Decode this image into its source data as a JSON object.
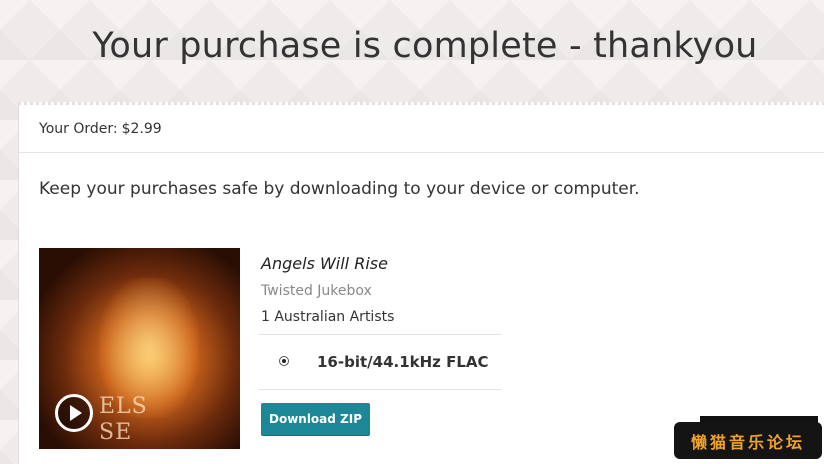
{
  "page": {
    "title": "Your purchase is complete - thankyou"
  },
  "order": {
    "label": "Your Order:",
    "total": "$2.99"
  },
  "message": "Keep your purchases safe by downloading to your device or computer.",
  "album": {
    "title": "Angels Will Rise",
    "artist": "Twisted Jukebox",
    "artists_count": "1 Australian Artists",
    "cover_text_line1": "ELS",
    "cover_text_line2": "SE"
  },
  "format": {
    "selected": "16-bit/44.1kHz FLAC"
  },
  "actions": {
    "download_label": "Download ZIP"
  },
  "watermark": {
    "text": "懒猫音乐论坛"
  },
  "colors": {
    "download_button": "#1b8797",
    "watermark_text": "#f0a32a"
  },
  "icons": {
    "play": "play-icon"
  }
}
